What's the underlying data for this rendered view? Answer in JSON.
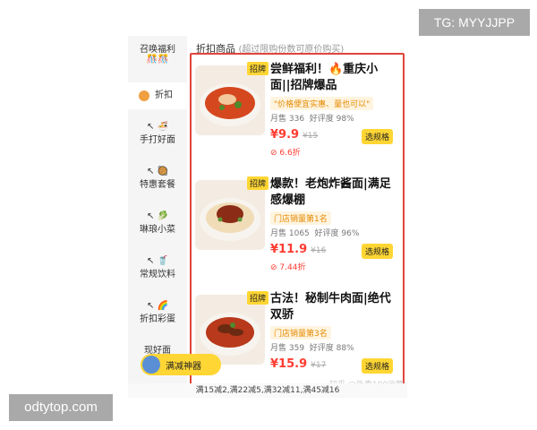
{
  "watermarks": {
    "top_right": "TG: MYYJJPP",
    "bottom_left": "odtytop.com",
    "zhihu": "知乎 @外卖100运营"
  },
  "sidebar": {
    "items": [
      {
        "label": "召唤福利",
        "sub": "🎊🎊",
        "active": false
      },
      {
        "label": "折扣",
        "active": true
      },
      {
        "label": "手打好面",
        "active": false
      },
      {
        "label": "特惠套餐",
        "active": false
      },
      {
        "label": "琳琅小菜",
        "active": false
      },
      {
        "label": "常规饮料",
        "active": false
      },
      {
        "label": "折扣彩蛋",
        "active": false
      },
      {
        "label": "现好面",
        "active": false
      }
    ]
  },
  "header": {
    "title": "折扣商品",
    "note": "(超过限购份数可原价购买)"
  },
  "products": [
    {
      "tag": "招牌",
      "title": "尝鲜福利！🔥重庆小面||招牌爆品",
      "pill": "\"价格便宜实惠、量也可以\"",
      "sales": "月售 336",
      "rating": "好评度 98%",
      "price": "¥9.9",
      "original": "¥15",
      "discount": "6.6折",
      "button": "选规格"
    },
    {
      "tag": "招牌",
      "title": "爆款！老炮炸酱面|满足感爆棚",
      "pill": "门店销量第1名",
      "sales": "月售 1065",
      "rating": "好评度 96%",
      "price": "¥11.9",
      "original": "¥16",
      "discount": "7.44折",
      "button": "选规格"
    },
    {
      "tag": "招牌",
      "title": "古法！秘制牛肉面|绝代双骄",
      "pill": "门店销量第3名",
      "sales": "月售 359",
      "rating": "好评度 88%",
      "price": "¥15.9",
      "original": "¥17",
      "button": "选规格"
    }
  ],
  "promo": {
    "label": "满减神器"
  },
  "bottom_bar": {
    "text": "满15减2,满22减5,满32减11,满45减16"
  },
  "colors": {
    "accent_yellow": "#ffd633",
    "price_red": "#ff3b30",
    "highlight_border": "#e0453b"
  }
}
